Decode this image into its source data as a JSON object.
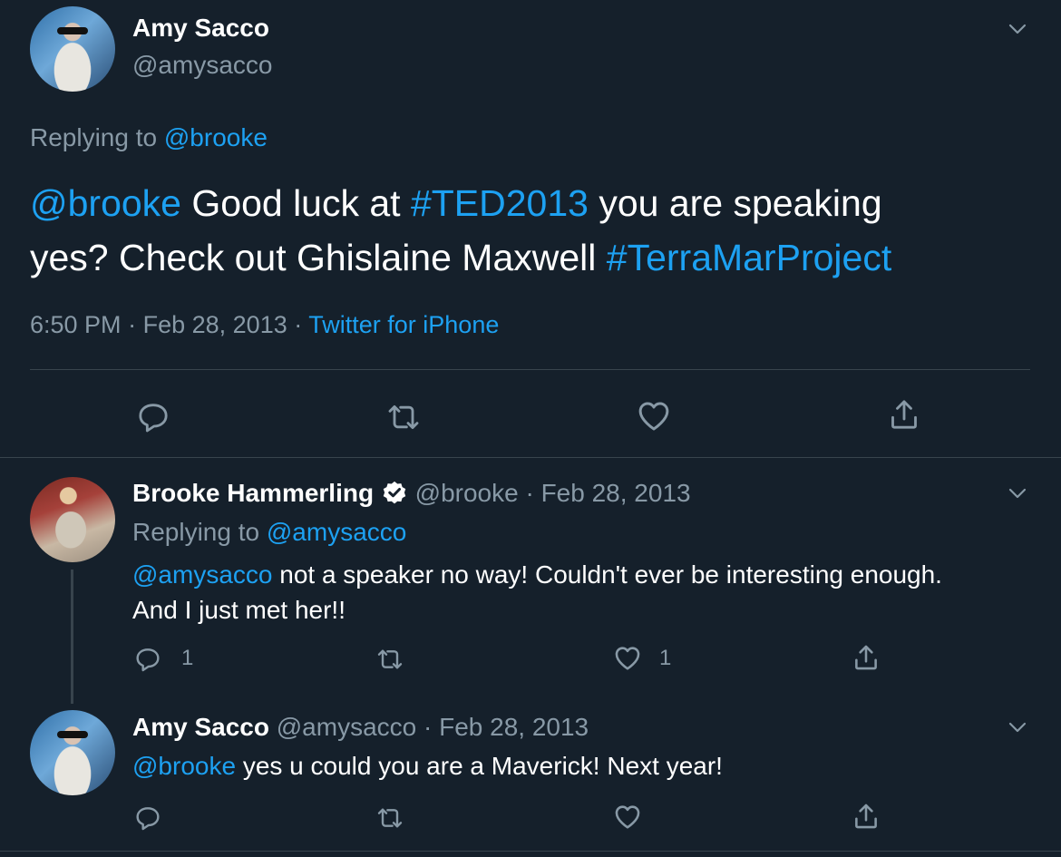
{
  "main_tweet": {
    "author_name": "Amy Sacco",
    "author_handle": "@amysacco",
    "replying_prefix": "Replying to",
    "replying_handle": "@brooke",
    "text_mention": "@brooke",
    "text_part1": " Good luck at ",
    "text_hashtag1": "#TED2013",
    "text_part2": " you are speaking",
    "text_part3": "yes? Check out Ghislaine Maxwell ",
    "text_hashtag2": "#TerraMarProject",
    "time": "6:50 PM",
    "date": "Feb 28, 2013",
    "source": "Twitter for iPhone",
    "separator": "·"
  },
  "reply1": {
    "author_name": "Brooke Hammerling",
    "author_handle": "@brooke",
    "date": "Feb 28, 2013",
    "separator": "·",
    "replying_prefix": "Replying to",
    "replying_handle": "@amysacco",
    "text_mention": "@amysacco",
    "text_line1": " not a speaker no way! Couldn't ever be interesting enough.",
    "text_line2": "And I just met her!!",
    "reply_count": "1",
    "like_count": "1"
  },
  "reply2": {
    "author_name": "Amy Sacco",
    "author_handle": "@amysacco",
    "date": "Feb 28, 2013",
    "separator": "·",
    "text_mention": "@brooke",
    "text_rest": " yes u could you are a Maverick! Next year!"
  },
  "icons": {
    "reply": "reply-icon",
    "retweet": "retweet-icon",
    "like": "heart-icon",
    "share": "share-icon",
    "menu": "chevron-down-icon",
    "verified": "verified-badge-icon"
  },
  "colors": {
    "background": "#15202b",
    "text": "#ffffff",
    "secondary": "#8899a6",
    "accent": "#1da1f2",
    "divider": "#38444d"
  }
}
